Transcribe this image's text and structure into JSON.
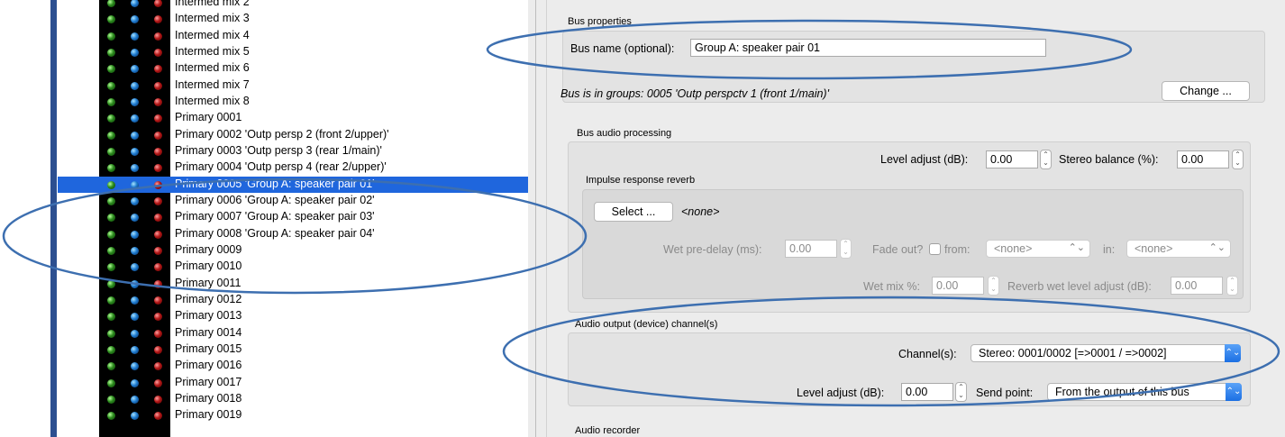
{
  "bus_list": {
    "rows": [
      {
        "label": "Intermed mix 2",
        "dim": false
      },
      {
        "label": "Intermed mix 3",
        "dim": false
      },
      {
        "label": "Intermed mix 4",
        "dim": false
      },
      {
        "label": "Intermed mix 5",
        "dim": false
      },
      {
        "label": "Intermed mix 6",
        "dim": false
      },
      {
        "label": "Intermed mix 7",
        "dim": false
      },
      {
        "label": "Intermed mix 8",
        "dim": false
      },
      {
        "label": "Primary 0001",
        "dim": false
      },
      {
        "label": "Primary 0002 'Outp persp 2 (front 2/upper)'",
        "dim": false
      },
      {
        "label": "Primary 0003 'Outp persp 3 (rear 1/main)'",
        "dim": false
      },
      {
        "label": "Primary 0004 'Outp persp 4 (rear 2/upper)'",
        "dim": false
      },
      {
        "label": "Primary 0005 'Group A: speaker pair 01'",
        "dim": false,
        "selected": true
      },
      {
        "label": "Primary 0006 'Group A: speaker pair 02'",
        "dim": false
      },
      {
        "label": "Primary 0007 'Group A: speaker pair 03'",
        "dim": false
      },
      {
        "label": "Primary 0008 'Group A: speaker pair 04'",
        "dim": false
      },
      {
        "label": "Primary 0009",
        "dim": false
      },
      {
        "label": "Primary 0010",
        "dim": false
      },
      {
        "label": "Primary 0011",
        "dim": false
      },
      {
        "label": "Primary 0012",
        "dim": false
      },
      {
        "label": "Primary 0013",
        "dim": false
      },
      {
        "label": "Primary 0014",
        "dim": false
      },
      {
        "label": "Primary 0015",
        "dim": false
      },
      {
        "label": "Primary 0016",
        "dim": false
      },
      {
        "label": "Primary 0017",
        "dim": false
      },
      {
        "label": "Primary 0018",
        "dim": false
      },
      {
        "label": "Primary 0019",
        "dim": false
      }
    ]
  },
  "bus_properties": {
    "group_title": "Bus properties",
    "bus_name_label": "Bus name (optional):",
    "bus_name_value": "Group A: speaker pair 01",
    "groups_text": "Bus is in groups: 0005 'Outp perspctv 1 (front 1/main)'",
    "change_button": "Change ..."
  },
  "audio_processing": {
    "group_title": "Bus audio processing",
    "level_adjust_label": "Level adjust (dB):",
    "level_adjust_value": "0.00",
    "stereo_balance_label": "Stereo balance (%):",
    "stereo_balance_value": "0.00",
    "reverb_title": "Impulse response reverb",
    "select_button": "Select ...",
    "reverb_file": "<none>",
    "wet_predelay_label": "Wet pre-delay (ms):",
    "wet_predelay_value": "0.00",
    "fade_out_label": "Fade out?",
    "from_label": "from:",
    "from_value": "<none>",
    "in_label": "in:",
    "in_value": "<none>",
    "wet_mix_label": "Wet mix %:",
    "wet_mix_value": "0.00",
    "reverb_wet_level_label": "Reverb wet level adjust (dB):",
    "reverb_wet_level_value": "0.00"
  },
  "audio_output": {
    "group_title": "Audio output (device) channel(s)",
    "channels_label": "Channel(s):",
    "channels_value": "Stereo: 0001/0002 [=>0001 / =>0002]",
    "level_adjust_label": "Level adjust (dB):",
    "level_adjust_value": "0.00",
    "send_point_label": "Send point:",
    "send_point_value": "From the output of this bus"
  },
  "audio_recorder": {
    "group_title": "Audio recorder"
  },
  "colors": {
    "selection": "#1f66dd",
    "annotation": "#3d6fb0",
    "left_border": "#2c4f90"
  }
}
